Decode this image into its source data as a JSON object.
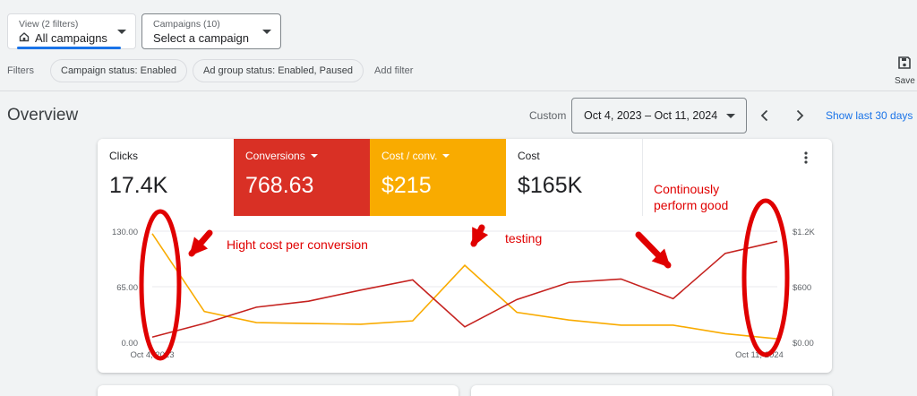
{
  "view_selector": {
    "sub": "View (2 filters)",
    "main": "All campaigns"
  },
  "campaign_selector": {
    "sub": "Campaigns (10)",
    "main": "Select a campaign"
  },
  "filters": {
    "label": "Filters",
    "chips": [
      "Campaign status: Enabled",
      "Ad group status: Enabled, Paused"
    ],
    "add_filter": "Add filter"
  },
  "save": {
    "label": "Save"
  },
  "overview": {
    "title": "Overview",
    "custom_label": "Custom",
    "date_range": "Oct 4, 2023 – Oct 11, 2024",
    "show_last": "Show last 30 days"
  },
  "metrics": [
    {
      "label": "Clicks",
      "value": "17.4K",
      "bg": "#ffffff",
      "fg": "#202124",
      "dropdown": false
    },
    {
      "label": "Conversions",
      "value": "768.63",
      "bg": "#d93025",
      "fg": "#ffffff",
      "dropdown": true
    },
    {
      "label": "Cost / conv.",
      "value": "$215",
      "bg": "#f9ab00",
      "fg": "#ffffff",
      "dropdown": true
    },
    {
      "label": "Cost",
      "value": "$165K",
      "bg": "#ffffff",
      "fg": "#202124",
      "dropdown": false
    }
  ],
  "chart_data": {
    "type": "line",
    "left_ticks": [
      "130.00",
      "65.00",
      "0.00"
    ],
    "right_ticks": [
      "$1.2K",
      "$600",
      "$0.00"
    ],
    "x_labels": [
      "Oct 4, 2023",
      "Oct 11, 2024"
    ],
    "ylim_left": [
      0,
      130
    ],
    "ylim_right": [
      0,
      1200
    ],
    "grid": true,
    "series": [
      {
        "name": "Cost / conv.",
        "axis": "left",
        "color": "#f9ab00",
        "values": [
          127,
          36,
          23,
          22,
          21,
          25,
          90,
          35,
          26,
          20,
          20,
          10,
          4
        ]
      },
      {
        "name": "Conversions",
        "axis": "left",
        "color": "#c5221f",
        "values": [
          6,
          22,
          41,
          48,
          61,
          73,
          18,
          50,
          70,
          74,
          51,
          104,
          118
        ]
      }
    ]
  },
  "annotations": {
    "hight_cost": "Hight cost per conversion",
    "testing": "testing",
    "continuous_line1": "Continously",
    "continuous_line2": "perform good"
  },
  "colors": {
    "accent": "#1a73e8",
    "annotation": "#e00000"
  }
}
